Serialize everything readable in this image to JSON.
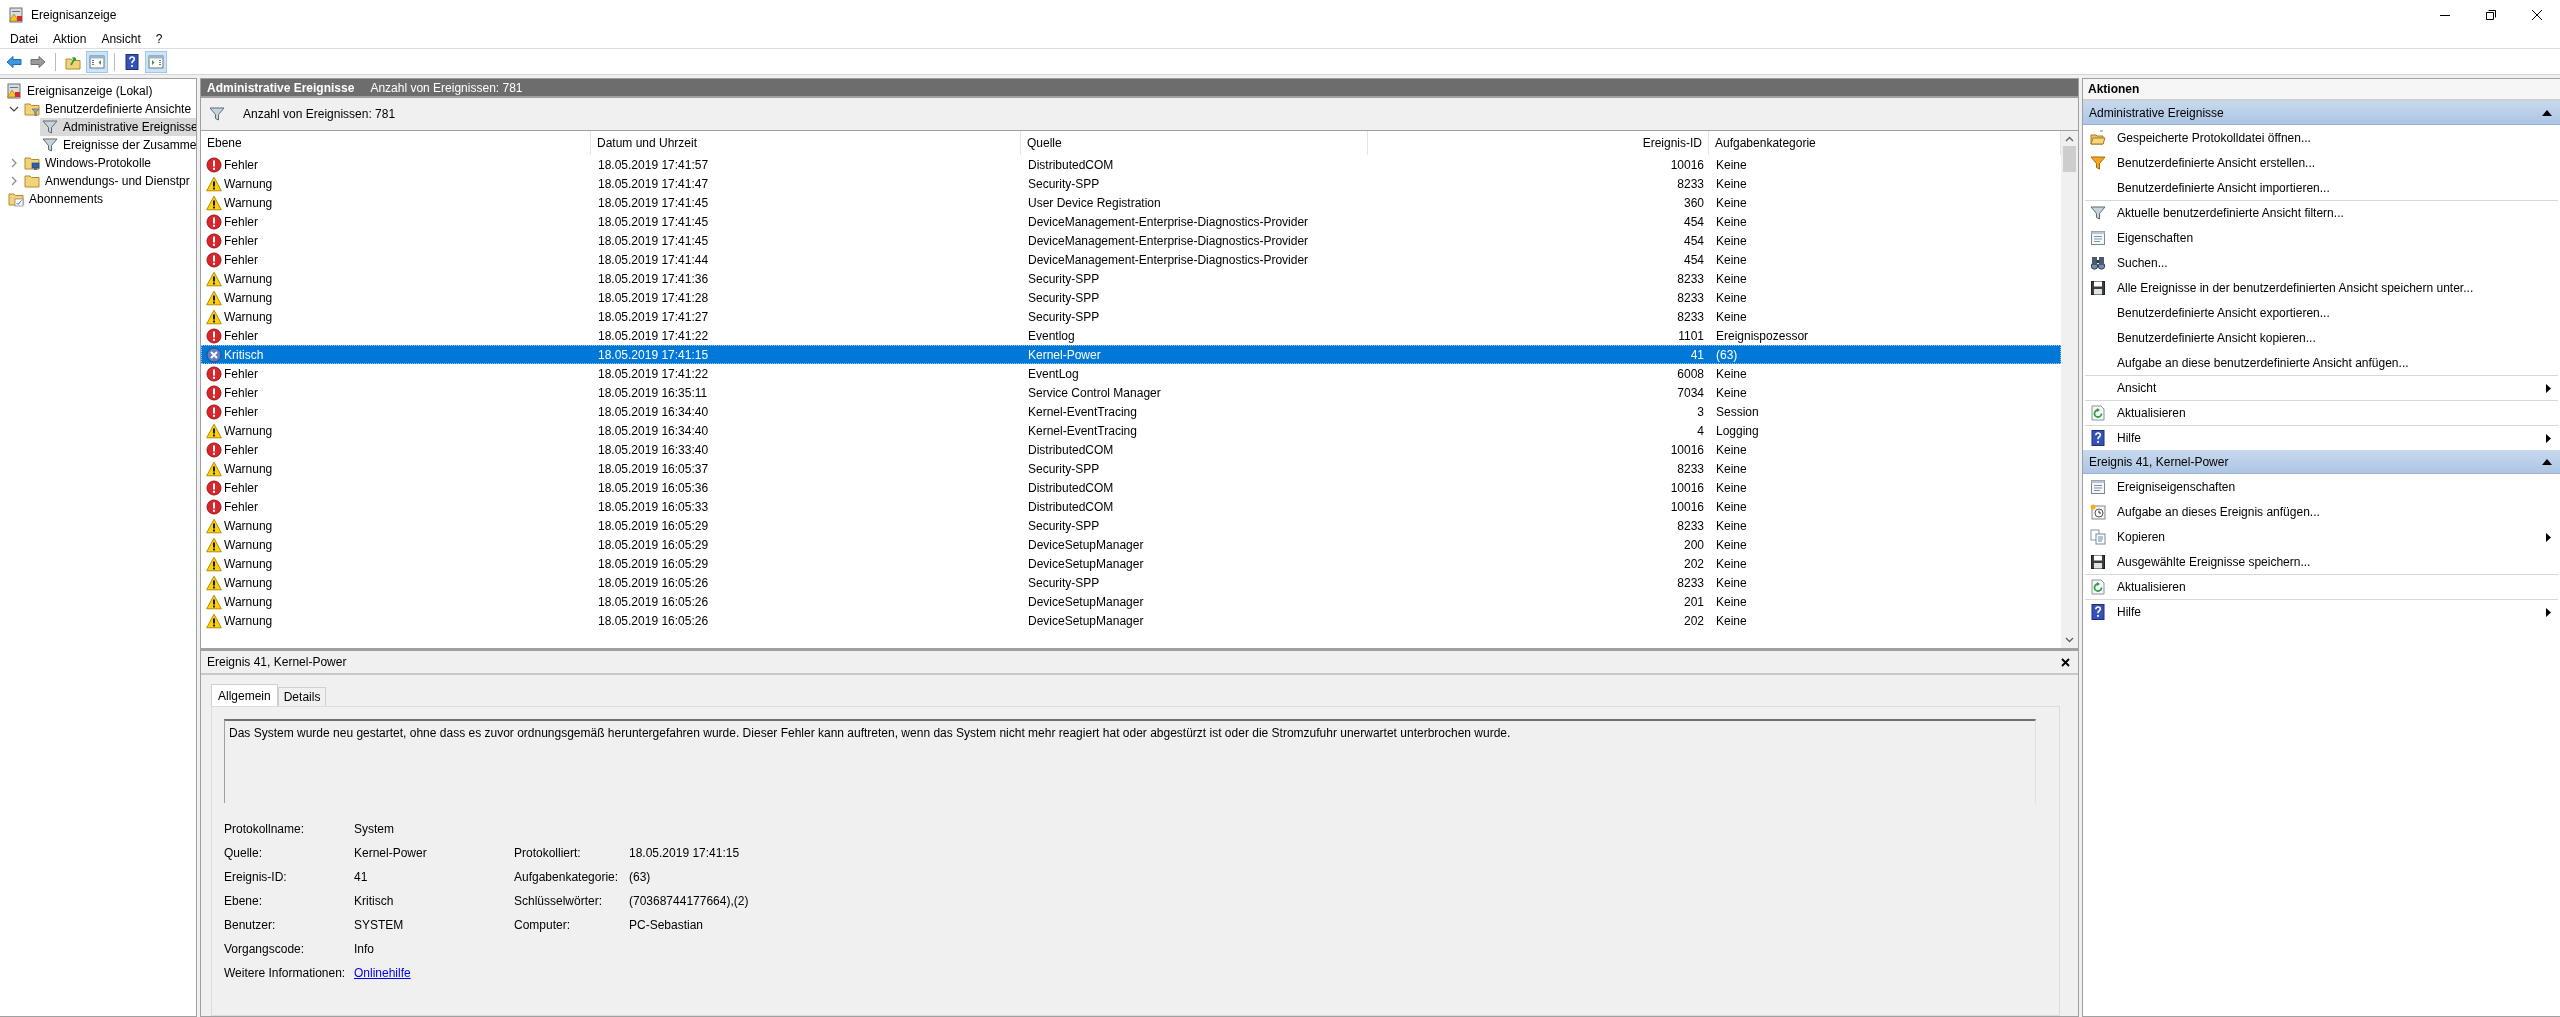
{
  "window": {
    "title": "Ereignisanzeige"
  },
  "menu": [
    "Datei",
    "Aktion",
    "Ansicht",
    "?"
  ],
  "toolbar": [
    {
      "kind": "back",
      "pressed": false
    },
    {
      "kind": "forward",
      "pressed": false
    },
    {
      "kind": "separator"
    },
    {
      "kind": "up",
      "pressed": false
    },
    {
      "kind": "tree-pane",
      "pressed": true
    },
    {
      "kind": "separator"
    },
    {
      "kind": "help",
      "pressed": false
    },
    {
      "kind": "action-pane",
      "pressed": true
    }
  ],
  "tree": [
    {
      "label": "Ereignisanzeige (Lokal)",
      "kind": "log",
      "selected": false,
      "children": [
        {
          "label": "Benutzerdefinierte Ansichte",
          "kind": "filter-folder",
          "expanded": true,
          "selected": false,
          "children": [
            {
              "label": "Administrative Ereignisse",
              "kind": "filter",
              "selected": true
            },
            {
              "label": "Ereignisse der Zusamme",
              "kind": "filter",
              "selected": false
            }
          ]
        },
        {
          "label": "Windows-Protokolle",
          "kind": "computer-folder",
          "expanded": false,
          "selected": false
        },
        {
          "label": "Anwendungs- und Dienstpr",
          "kind": "folder",
          "expanded": false,
          "selected": false
        },
        {
          "label": "Abonnements",
          "kind": "subscription",
          "selected": false
        }
      ]
    }
  ],
  "view_header": {
    "title": "Administrative Ereignisse",
    "count": "Anzahl von Ereignissen: 781"
  },
  "filter_bar": {
    "text": "Anzahl von Ereignissen: 781"
  },
  "table": {
    "columns": [
      "Ebene",
      "Datum und Uhrzeit",
      "Quelle",
      "Ereignis-ID",
      "Aufgabenkategorie"
    ],
    "rows": [
      {
        "kind": "error",
        "cells": [
          "Fehler",
          "18.05.2019 17:41:57",
          "DistributedCOM",
          "10016",
          "Keine"
        ],
        "selected": false
      },
      {
        "kind": "warning",
        "cells": [
          "Warnung",
          "18.05.2019 17:41:47",
          "Security-SPP",
          "8233",
          "Keine"
        ],
        "selected": false
      },
      {
        "kind": "warning",
        "cells": [
          "Warnung",
          "18.05.2019 17:41:45",
          "User Device Registration",
          "360",
          "Keine"
        ],
        "selected": false
      },
      {
        "kind": "error",
        "cells": [
          "Fehler",
          "18.05.2019 17:41:45",
          "DeviceManagement-Enterprise-Diagnostics-Provider",
          "454",
          "Keine"
        ],
        "selected": false
      },
      {
        "kind": "error",
        "cells": [
          "Fehler",
          "18.05.2019 17:41:45",
          "DeviceManagement-Enterprise-Diagnostics-Provider",
          "454",
          "Keine"
        ],
        "selected": false
      },
      {
        "kind": "error",
        "cells": [
          "Fehler",
          "18.05.2019 17:41:44",
          "DeviceManagement-Enterprise-Diagnostics-Provider",
          "454",
          "Keine"
        ],
        "selected": false
      },
      {
        "kind": "warning",
        "cells": [
          "Warnung",
          "18.05.2019 17:41:36",
          "Security-SPP",
          "8233",
          "Keine"
        ],
        "selected": false
      },
      {
        "kind": "warning",
        "cells": [
          "Warnung",
          "18.05.2019 17:41:28",
          "Security-SPP",
          "8233",
          "Keine"
        ],
        "selected": false
      },
      {
        "kind": "warning",
        "cells": [
          "Warnung",
          "18.05.2019 17:41:27",
          "Security-SPP",
          "8233",
          "Keine"
        ],
        "selected": false
      },
      {
        "kind": "error",
        "cells": [
          "Fehler",
          "18.05.2019 17:41:22",
          "Eventlog",
          "1101",
          "Ereignispozessor"
        ],
        "selected": false
      },
      {
        "kind": "critical",
        "cells": [
          "Kritisch",
          "18.05.2019 17:41:15",
          "Kernel-Power",
          "41",
          "(63)"
        ],
        "selected": true
      },
      {
        "kind": "error",
        "cells": [
          "Fehler",
          "18.05.2019 17:41:22",
          "EventLog",
          "6008",
          "Keine"
        ],
        "selected": false
      },
      {
        "kind": "error",
        "cells": [
          "Fehler",
          "18.05.2019 16:35:11",
          "Service Control Manager",
          "7034",
          "Keine"
        ],
        "selected": false
      },
      {
        "kind": "error",
        "cells": [
          "Fehler",
          "18.05.2019 16:34:40",
          "Kernel-EventTracing",
          "3",
          "Session"
        ],
        "selected": false
      },
      {
        "kind": "warning",
        "cells": [
          "Warnung",
          "18.05.2019 16:34:40",
          "Kernel-EventTracing",
          "4",
          "Logging"
        ],
        "selected": false
      },
      {
        "kind": "error",
        "cells": [
          "Fehler",
          "18.05.2019 16:33:40",
          "DistributedCOM",
          "10016",
          "Keine"
        ],
        "selected": false
      },
      {
        "kind": "warning",
        "cells": [
          "Warnung",
          "18.05.2019 16:05:37",
          "Security-SPP",
          "8233",
          "Keine"
        ],
        "selected": false
      },
      {
        "kind": "error",
        "cells": [
          "Fehler",
          "18.05.2019 16:05:36",
          "DistributedCOM",
          "10016",
          "Keine"
        ],
        "selected": false
      },
      {
        "kind": "error",
        "cells": [
          "Fehler",
          "18.05.2019 16:05:33",
          "DistributedCOM",
          "10016",
          "Keine"
        ],
        "selected": false
      },
      {
        "kind": "warning",
        "cells": [
          "Warnung",
          "18.05.2019 16:05:29",
          "Security-SPP",
          "8233",
          "Keine"
        ],
        "selected": false
      },
      {
        "kind": "warning",
        "cells": [
          "Warnung",
          "18.05.2019 16:05:29",
          "DeviceSetupManager",
          "200",
          "Keine"
        ],
        "selected": false
      },
      {
        "kind": "warning",
        "cells": [
          "Warnung",
          "18.05.2019 16:05:29",
          "DeviceSetupManager",
          "202",
          "Keine"
        ],
        "selected": false
      },
      {
        "kind": "warning",
        "cells": [
          "Warnung",
          "18.05.2019 16:05:26",
          "Security-SPP",
          "8233",
          "Keine"
        ],
        "selected": false
      },
      {
        "kind": "warning",
        "cells": [
          "Warnung",
          "18.05.2019 16:05:26",
          "DeviceSetupManager",
          "201",
          "Keine"
        ],
        "selected": false
      },
      {
        "kind": "warning",
        "cells": [
          "Warnung",
          "18.05.2019 16:05:26",
          "DeviceSetupManager",
          "202",
          "Keine"
        ],
        "selected": false
      }
    ]
  },
  "details": {
    "title": "Ereignis 41, Kernel-Power",
    "tabs": [
      {
        "label": "Allgemein",
        "selected": true
      },
      {
        "label": "Details",
        "selected": false
      }
    ],
    "description": "Das System wurde neu gestartet, ohne dass es zuvor ordnungsgemäß heruntergefahren wurde. Dieser Fehler kann auftreten, wenn das System nicht mehr reagiert hat oder abgestürzt ist oder die Stromzufuhr unerwartet unterbrochen wurde.",
    "fields": [
      {
        "label": "Protokollname:",
        "value": "System"
      },
      {
        "label": "Quelle:",
        "value": "Kernel-Power",
        "label_2": "Protokolliert:",
        "value_2": "18.05.2019 17:41:15"
      },
      {
        "label": "Ereignis-ID:",
        "value": "41",
        "label_2": "Aufgabenkategorie:",
        "value_2": "(63)"
      },
      {
        "label": "Ebene:",
        "value": "Kritisch",
        "label_2": "Schlüsselwörter:",
        "value_2": "(70368744177664),(2)"
      },
      {
        "label": "Benutzer:",
        "value": "SYSTEM",
        "label_2": "Computer:",
        "value_2": "PC-Sebastian"
      },
      {
        "label": "Vorgangscode:",
        "value": "Info"
      }
    ],
    "more_info": {
      "label": "Weitere Informationen:",
      "link": "Onlinehilfe"
    }
  },
  "actions": {
    "title": "Aktionen",
    "sections": [
      {
        "title": "Administrative Ereignisse",
        "expanded": true,
        "items": [
          {
            "label": "Gespeicherte Protokolldatei öffnen...",
            "kind": "open",
            "submenu": false,
            "rule_above": false
          },
          {
            "label": "Benutzerdefinierte Ansicht erstellen...",
            "kind": "filter-create",
            "submenu": false,
            "rule_above": false
          },
          {
            "label": "Benutzerdefinierte Ansicht importieren...",
            "kind": "plain",
            "submenu": false,
            "rule_above": false
          },
          {
            "label": "Aktuelle benutzerdefinierte Ansicht filtern...",
            "kind": "filter",
            "submenu": false,
            "rule_above": true
          },
          {
            "label": "Eigenschaften",
            "kind": "properties",
            "submenu": false,
            "rule_above": false
          },
          {
            "label": "Suchen...",
            "kind": "find",
            "submenu": false,
            "rule_above": false
          },
          {
            "label": "Alle Ereignisse in der benutzerdefinierten Ansicht speichern unter...",
            "kind": "save",
            "submenu": false,
            "rule_above": false
          },
          {
            "label": "Benutzerdefinierte Ansicht exportieren...",
            "kind": "plain",
            "submenu": false,
            "rule_above": false
          },
          {
            "label": "Benutzerdefinierte Ansicht kopieren...",
            "kind": "plain",
            "submenu": false,
            "rule_above": false
          },
          {
            "label": "Aufgabe an diese benutzerdefinierte Ansicht anfügen...",
            "kind": "plain",
            "submenu": false,
            "rule_above": false
          },
          {
            "label": "Ansicht",
            "kind": "plain",
            "submenu": true,
            "rule_above": true
          },
          {
            "label": "Aktualisieren",
            "kind": "refresh",
            "submenu": false,
            "rule_above": true
          },
          {
            "label": "Hilfe",
            "kind": "help",
            "submenu": true,
            "rule_above": true
          }
        ]
      },
      {
        "title": "Ereignis 41, Kernel-Power",
        "expanded": true,
        "items": [
          {
            "label": "Ereigniseigenschaften",
            "kind": "properties",
            "submenu": false,
            "rule_above": false
          },
          {
            "label": "Aufgabe an dieses Ereignis anfügen...",
            "kind": "task",
            "submenu": false,
            "rule_above": false
          },
          {
            "label": "Kopieren",
            "kind": "copy",
            "submenu": true,
            "rule_above": false
          },
          {
            "label": "Ausgewählte Ereignisse speichern...",
            "kind": "save",
            "submenu": false,
            "rule_above": false
          },
          {
            "label": "Aktualisieren",
            "kind": "refresh",
            "submenu": false,
            "rule_above": true
          },
          {
            "label": "Hilfe",
            "kind": "help",
            "submenu": true,
            "rule_above": true
          }
        ]
      }
    ]
  }
}
